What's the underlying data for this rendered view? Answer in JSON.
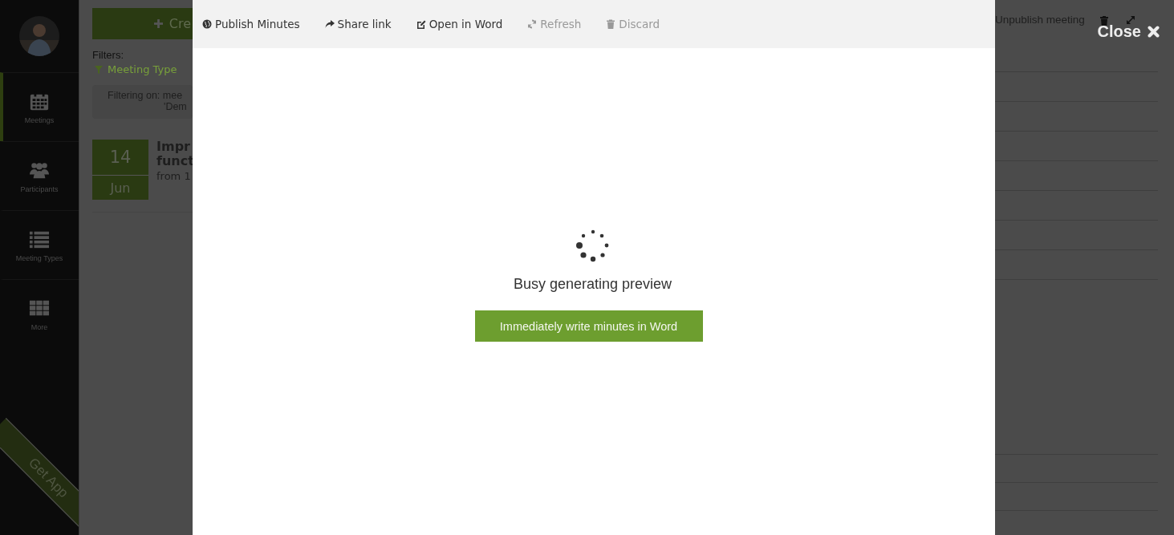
{
  "sidebar": {
    "items": [
      {
        "label": "Meetings",
        "selected": true
      },
      {
        "label": "Participants",
        "selected": false
      },
      {
        "label": "Meeting Types",
        "selected": false
      },
      {
        "label": "More",
        "selected": false
      }
    ],
    "ribbon": "Get App"
  },
  "background": {
    "create_button": "Cre",
    "filters_label": "Filters:",
    "filter_chip": "Meeting Type",
    "filter_notice": [
      "Filtering on: mee",
      "'Dem"
    ],
    "meeting": {
      "day": "14",
      "month": "Jun",
      "title": [
        "Impr",
        "funct"
      ],
      "time": "from 1"
    },
    "header_action": "Unpublish meeting"
  },
  "modal": {
    "toolbar": [
      {
        "label": "Publish Minutes",
        "disabled": false
      },
      {
        "label": "Share link",
        "disabled": false
      },
      {
        "label": "Open in Word",
        "disabled": false
      },
      {
        "label": "Refresh",
        "disabled": true
      },
      {
        "label": "Discard",
        "disabled": true
      }
    ],
    "status": "Busy generating preview",
    "button": "Immediately write minutes in Word"
  },
  "close": "Close"
}
